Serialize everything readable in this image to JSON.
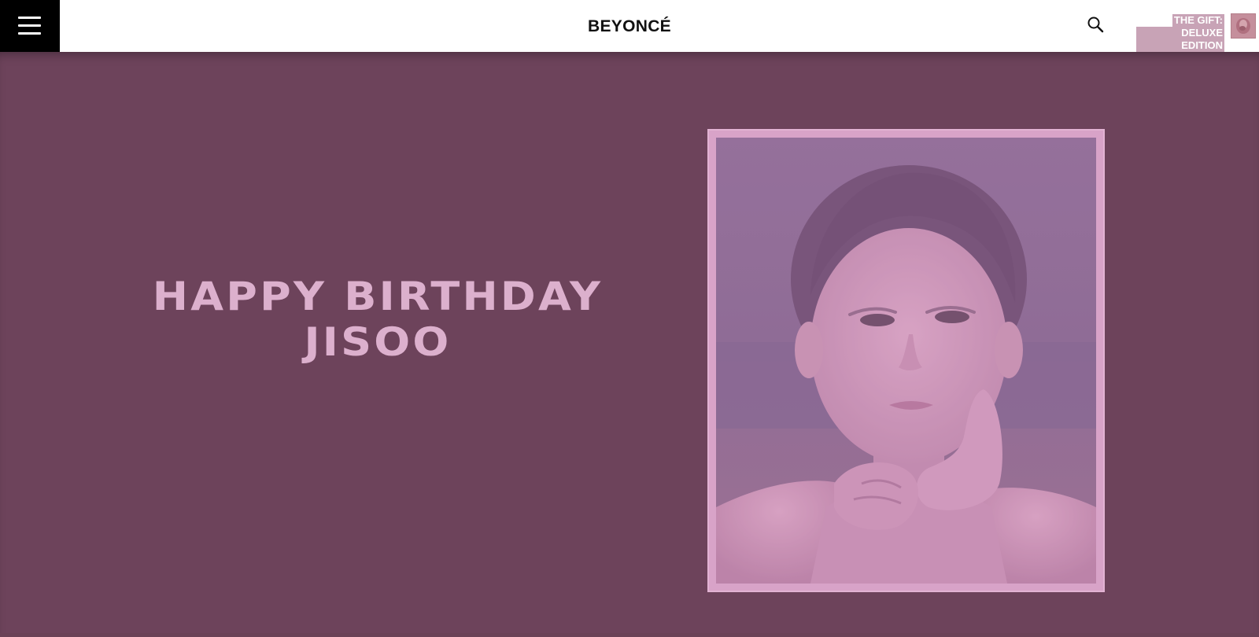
{
  "header": {
    "brand": "BEYONCÉ",
    "menu_icon": "hamburger-menu-icon",
    "search_icon": "search-icon",
    "promo": {
      "line1": "THE GIFT:",
      "line2": "DELUXE EDITION",
      "thumb_icon": "album-cover-thumbnail"
    }
  },
  "hero": {
    "line1": "HAPPY BIRTHDAY",
    "line2": "JISOO",
    "background": "#6d435b",
    "text_color": "#dcb0cd",
    "frame_color": "#d8a3c8"
  }
}
